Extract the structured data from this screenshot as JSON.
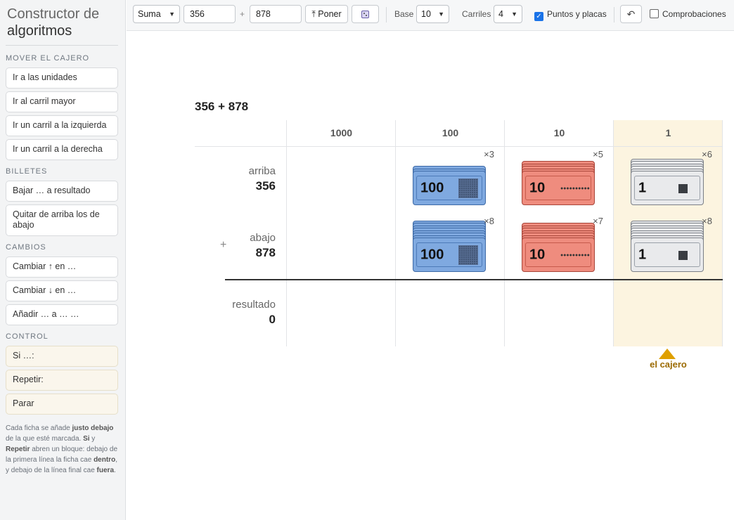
{
  "sidebar": {
    "title_line1": "Constructor de",
    "title_line2": "algoritmos",
    "sections": {
      "move": {
        "label": "MOVER EL CAJERO",
        "items": [
          "Ir a las unidades",
          "Ir al carril mayor",
          "Ir un carril a la izquierda",
          "Ir un carril a la derecha"
        ]
      },
      "bills": {
        "label": "BILLETES",
        "items": [
          "Bajar … a resultado",
          "Quitar de arriba los de abajo"
        ]
      },
      "changes": {
        "label": "CAMBIOS",
        "items": [
          "Cambiar ↑ en …",
          "Cambiar ↓ en …",
          "Añadir … a … …"
        ]
      },
      "control": {
        "label": "CONTROL",
        "items": [
          "Si …:",
          "Repetir:",
          "Parar"
        ]
      }
    },
    "help": {
      "t1": "Cada ficha se añade ",
      "b1": "justo debajo",
      "t2": " de la que esté marcada. ",
      "b2": "Si",
      "t3": " y ",
      "b3": "Repetir",
      "t4": " abren un bloque: debajo de la primera línea la ficha cae ",
      "b4": "dentro",
      "t5": ", y debajo de la línea final cae ",
      "b5": "fuera",
      "t6": "."
    }
  },
  "toolbar": {
    "operation": "Suma",
    "operand_a": "356",
    "plus": "+",
    "operand_b": "878",
    "put_label": "⤒ Poner",
    "dice_icon": "dice-icon",
    "base_label": "Base",
    "base_value": "10",
    "lanes_label": "Carriles",
    "lanes_value": "4",
    "dots_label": "Puntos y placas",
    "dots_checked": true,
    "undo_icon": "undo-icon",
    "checks_label": "Comprobaciones",
    "checks_checked": false
  },
  "board": {
    "title": "356 + 878",
    "columns": [
      "1000",
      "100",
      "10",
      "1"
    ],
    "rows": {
      "top": {
        "label": "arriba",
        "value": "356"
      },
      "bottom": {
        "label": "abajo",
        "value": "878"
      },
      "result": {
        "label": "resultado",
        "value": "0"
      }
    },
    "plus_sign": "+",
    "top_stacks": [
      {
        "denom": "100",
        "count": "×3",
        "n": 3,
        "color": "blue"
      },
      {
        "denom": "10",
        "count": "×5",
        "n": 5,
        "color": "red"
      },
      {
        "denom": "1",
        "count": "×6",
        "n": 6,
        "color": "white"
      }
    ],
    "bottom_stacks": [
      {
        "denom": "100",
        "count": "×8",
        "n": 8,
        "color": "blue"
      },
      {
        "denom": "10",
        "count": "×7",
        "n": 7,
        "color": "red"
      },
      {
        "denom": "1",
        "count": "×8",
        "n": 8,
        "color": "white"
      }
    ],
    "cashier_label": "el cajero",
    "cashier_column": "1"
  },
  "colors": {
    "blue_bill": "#7fa9e0",
    "red_bill": "#ef8c7e",
    "white_bill": "#e9eaec",
    "cashier": "#dfa000",
    "units_highlight": "#fcf4e0"
  }
}
